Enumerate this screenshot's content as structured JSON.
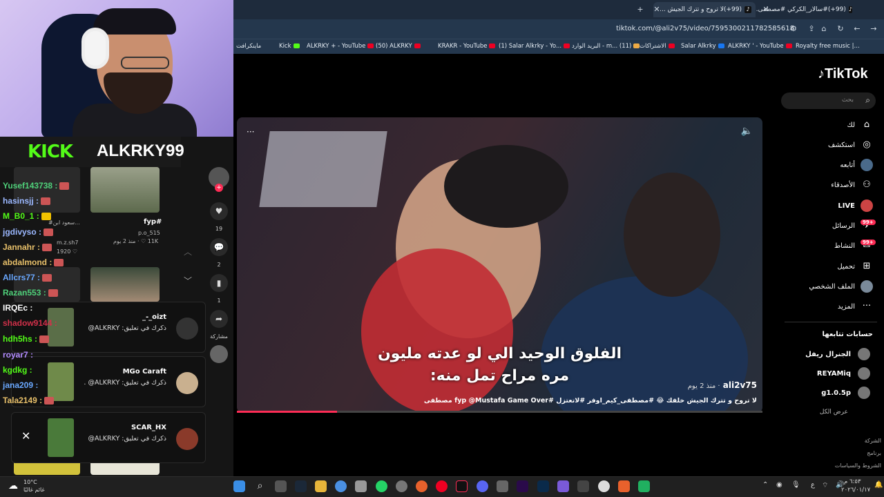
{
  "browser": {
    "tabs": [
      {
        "label": "(99+)#سالار_الكركي #مصطفى..."
      },
      {
        "label": "(99+)لا تروح و تترك الجيش ..."
      }
    ],
    "url": "tiktok.com/@ali2v75/video/7595300211782585618",
    "bookmarks": [
      "Royalty free music |...",
      "ALKRKY ' - YouTube",
      "Salar Alkrky",
      "الاشتراكات",
      "البريد الوارد - m... (11)",
      "(1) Salar Alkrky - Yo...",
      "KRAKR - YouTube",
      "(50) ALKRKY",
      "ALKRKY + - YouTube",
      "Kick",
      "ماينكرافت"
    ]
  },
  "stream": {
    "kick_label": "KICK",
    "channel_name": "ALKRKY99",
    "chat": [
      {
        "user": "Yusef143738 :",
        "color": "#4fd17a"
      },
      {
        "user": "hasinsjj :",
        "color": "#9bb8ff"
      },
      {
        "user": "M_B0_1 :",
        "color": "#53fc18"
      },
      {
        "user": "jgdivyso :",
        "color": "#9bb8ff"
      },
      {
        "user": "Jannahr :",
        "color": "#e8c06a"
      },
      {
        "user": "abdalmond :",
        "color": "#e8c06a"
      },
      {
        "user": "Allcrs77 :",
        "color": "#6aa8ff"
      },
      {
        "user": "Razan553 :",
        "color": "#4fd17a"
      },
      {
        "user": "IRQEc :",
        "color": "#ffffff"
      },
      {
        "user": "shadow9144 :",
        "color": "#d2304a"
      },
      {
        "user": "hdh5hs :",
        "color": "#53fc18"
      },
      {
        "user": "royar7 :",
        "color": "#b38cff"
      },
      {
        "user": "kgdkg :",
        "color": "#53fc18"
      },
      {
        "user": "jana209 :",
        "color": "#6aa8ff"
      },
      {
        "user": "Tala2149 :",
        "color": "#e8c06a"
      }
    ]
  },
  "explore": {
    "fyp_title": "fyp#",
    "fyp_user": "p.o_515",
    "fyp_meta": "11K ♡ · منذ 2 يوم",
    "mid_user": "m.z.sh7",
    "mid_count": "1920 ♡",
    "mid_tag": "#سعود ابن..."
  },
  "notifications": [
    {
      "name": "_-_oizt",
      "text": "ذكرك في تعليق: ALKRKY@"
    },
    {
      "name": "MGo Caraft",
      "text": "ذكرك في تعليق: ALKRKY@ ."
    },
    {
      "name": "SCAR_HX",
      "text": "ذكرك في تعليق: ALKRKY@"
    }
  ],
  "side_actions": {
    "likes": "19",
    "comments": "2",
    "saves": "1",
    "share": "مشاركة"
  },
  "video": {
    "subtitle_line1": "الفلوق الوحيد الي لو عدته مليون",
    "subtitle_line2": "مره مراح تمل منه:",
    "author": "ali2v75",
    "date": "منذ 2 يوم",
    "caption": "لا تروح و تترك الجيش خلفك 😂 #مصطفى_كيم_اوفر #لاتعتزل #fyp @Mustafa Game Over مصطفى",
    "progress": 0.19
  },
  "tiktok": {
    "logo": "TikTok",
    "search_placeholder": "بحث",
    "nav": [
      {
        "label": "لك",
        "icon": "home-icon",
        "glyph": "⌂"
      },
      {
        "label": "استكشف",
        "icon": "compass-icon",
        "glyph": "◎"
      },
      {
        "label": "أتابعه",
        "icon": "following-icon",
        "glyph": "●"
      },
      {
        "label": "الأصدقاء",
        "icon": "friends-icon",
        "glyph": "👥"
      },
      {
        "label": "LIVE",
        "icon": "live-icon",
        "glyph": "●"
      },
      {
        "label": "الرسائل",
        "icon": "messages-icon",
        "glyph": "✈",
        "badge": "99+"
      },
      {
        "label": "النشاط",
        "icon": "activity-icon",
        "glyph": "✉",
        "badge": "99+"
      },
      {
        "label": "تحميل",
        "icon": "upload-icon",
        "glyph": "⊞"
      },
      {
        "label": "الملف الشخصي",
        "icon": "profile-icon",
        "glyph": "●"
      },
      {
        "label": "المزيد",
        "icon": "more-icon",
        "glyph": "···"
      }
    ],
    "following_title": "حسابات تتابعها",
    "following": [
      "الجنرال ريفل",
      "REYAMiq",
      "g1.0.5p"
    ],
    "show_all": "عرض الكل",
    "footer": [
      "الشركة",
      "برنامج",
      "الشروط والسياسات"
    ]
  },
  "taskbar": {
    "weather_temp": "10°C",
    "weather_text": "غائم غالبًا",
    "time": "٦:٥٣ م",
    "date": "٢٠٢٦/٠١/١٧",
    "lang": "ع"
  }
}
